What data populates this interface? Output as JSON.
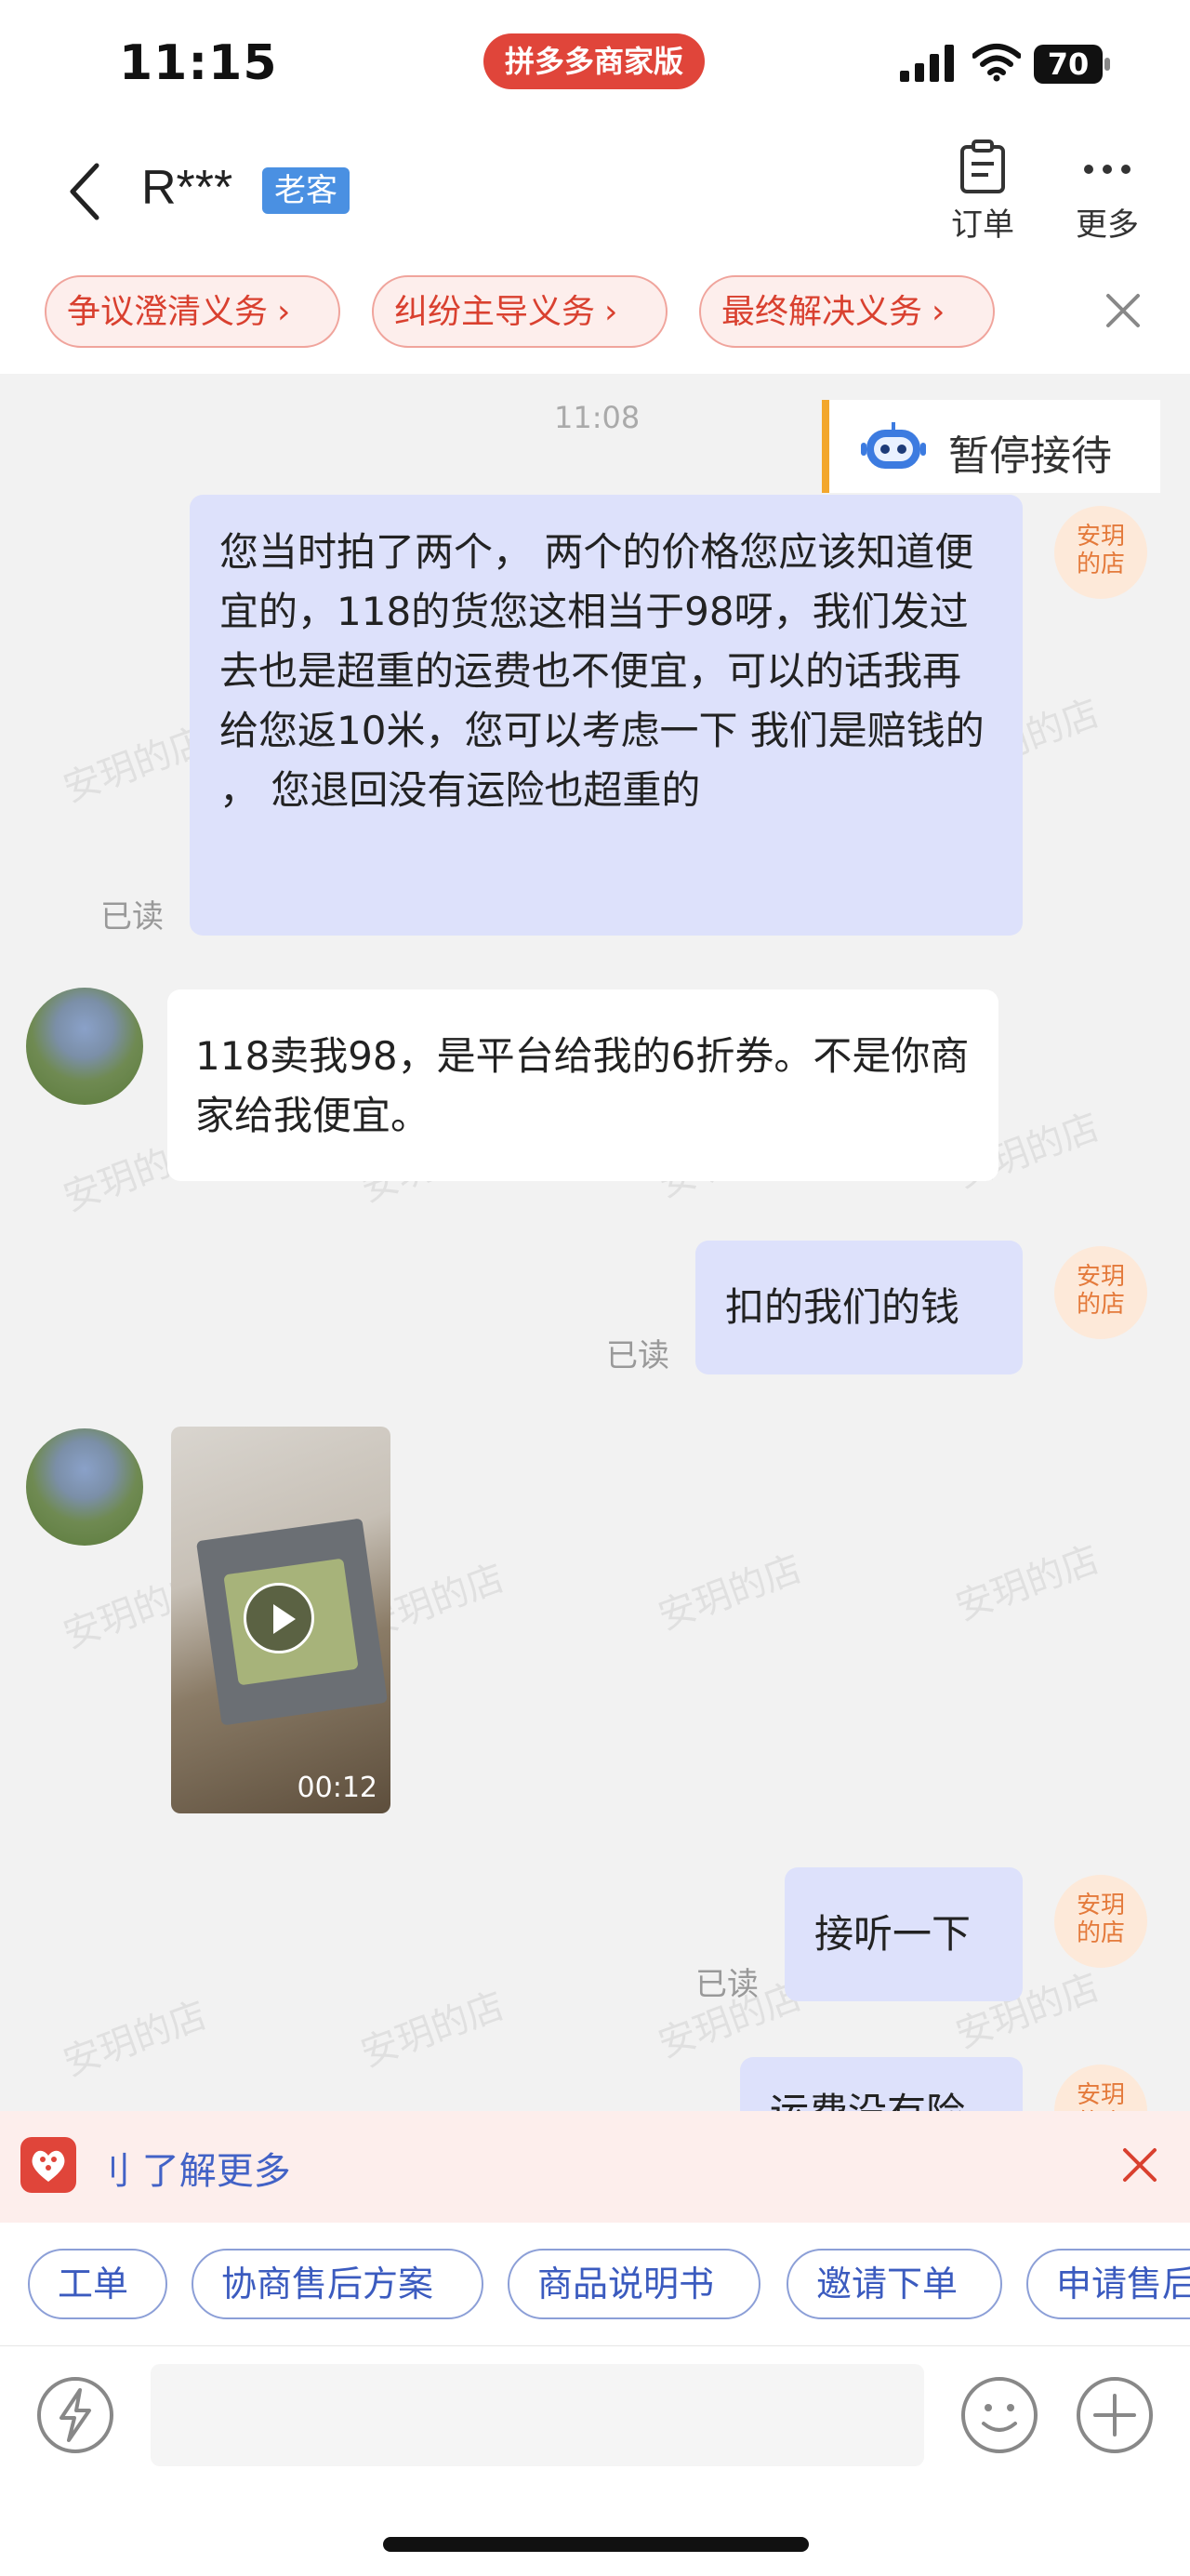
{
  "status_bar": {
    "time": "11:15",
    "app_pill": "拼多多商家版",
    "battery": "70"
  },
  "header": {
    "contact_name": "R***",
    "badge": "老客",
    "order_label": "订单",
    "more_label": "更多"
  },
  "obligation_chips": [
    {
      "label": "争议澄清义务"
    },
    {
      "label": "纠纷主导义务"
    },
    {
      "label": "最终解决义务"
    }
  ],
  "chat": {
    "timestamp": "11:08",
    "pause_label": "暂停接待",
    "shop_avatar_text": "安玥\n的店",
    "messages": [
      {
        "from": "merchant",
        "text": "您当时拍了两个，  两个的价格您应该知道便宜的，118的货您这相当于98呀，我们发过去也是超重的运费也不便宜，可以的话我再给您返10米，您可以考虑一下 我们是赔钱的 ，  您退回没有运险也超重的",
        "read": "已读"
      },
      {
        "from": "customer",
        "text": "118卖我98，是平台给我的6折券。不是你商家给我便宜。"
      },
      {
        "from": "merchant",
        "text": "扣的我们的钱",
        "read": "已读"
      },
      {
        "from": "customer",
        "type": "video",
        "duration": "00:12"
      },
      {
        "from": "merchant",
        "text": "接听一下",
        "read": "已读"
      },
      {
        "from": "merchant",
        "text": "运费没有险",
        "partial": true
      }
    ]
  },
  "watermark_text": "安玥的店",
  "notice": {
    "text": "刂 了解更多"
  },
  "quick_actions": [
    {
      "label": "工单"
    },
    {
      "label": "协商售后方案"
    },
    {
      "label": "商品说明书"
    },
    {
      "label": "邀请下单"
    },
    {
      "label": "申请售后"
    }
  ],
  "colors": {
    "accent_red": "#e0453a",
    "merchant_bubble": "#dde1fb",
    "customer_bubble": "#ffffff",
    "link_blue": "#3b5bbf",
    "pause_bar": "#f3a72c"
  }
}
